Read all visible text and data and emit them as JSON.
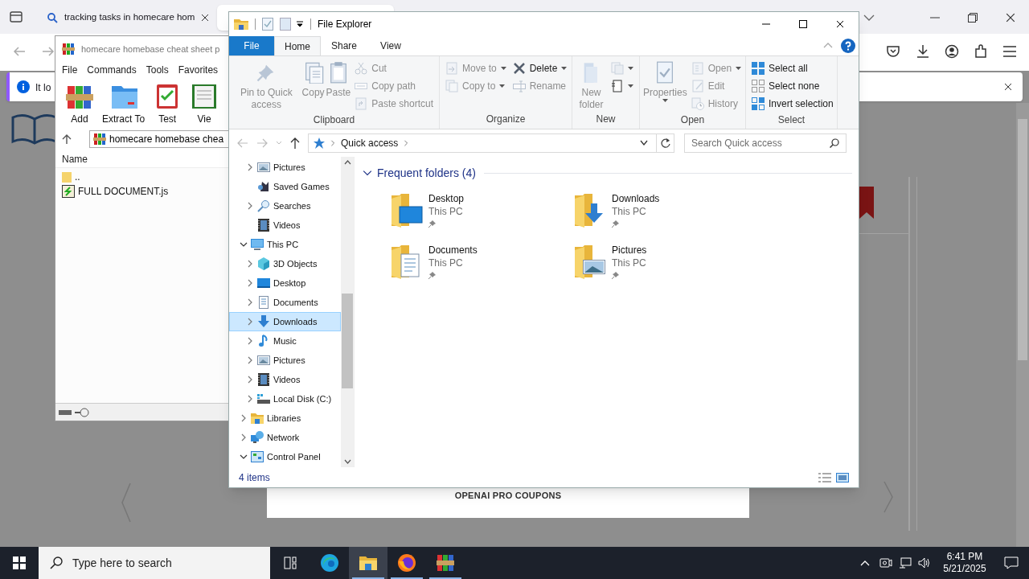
{
  "browser": {
    "tabs": [
      {
        "title": "tracking tasks in homecare hom",
        "selected": false
      },
      {
        "selected": true
      }
    ],
    "notification": "It lo"
  },
  "page": {
    "heading": "OPENAI PRO COUPONS"
  },
  "winrar": {
    "title": "homecare homebase cheat sheet p",
    "menu": [
      "File",
      "Commands",
      "Tools",
      "Favorites"
    ],
    "toolbar": [
      "Add",
      "Extract To",
      "Test",
      "Vie"
    ],
    "address": "homecare homebase chea",
    "column": "Name",
    "files": [
      {
        "name": ".."
      },
      {
        "name": "FULL DOCUMENT.js"
      }
    ]
  },
  "explorer": {
    "title": "File Explorer",
    "tabs": [
      {
        "label": "File",
        "kind": "file",
        "selected": false
      },
      {
        "label": "Home",
        "kind": "tab",
        "selected": true
      },
      {
        "label": "Share",
        "kind": "tab",
        "selected": false
      },
      {
        "label": "View",
        "kind": "tab",
        "selected": false
      }
    ],
    "ribbon": [
      {
        "label": "Clipboard",
        "items": [
          {
            "kind": "large",
            "label": "Pin to Quick access",
            "disabled": true,
            "menu": false
          },
          {
            "kind": "large",
            "label": "Copy",
            "disabled": true,
            "menu": false
          },
          {
            "kind": "large",
            "label": "Paste",
            "disabled": true,
            "menu": false
          },
          {
            "kind": "stack",
            "commands": [
              {
                "label": "Cut",
                "disabled": true,
                "menu": false
              },
              {
                "label": "Copy path",
                "disabled": true,
                "menu": false
              },
              {
                "label": "Paste shortcut",
                "disabled": true,
                "menu": false
              }
            ]
          }
        ]
      },
      {
        "label": "Organize",
        "items": [
          {
            "kind": "stack",
            "commands": [
              {
                "label": "Move to",
                "disabled": true,
                "menu": true
              },
              {
                "label": "Copy to",
                "disabled": true,
                "menu": true
              }
            ]
          },
          {
            "kind": "stack",
            "commands": [
              {
                "label": "Delete",
                "disabled": false,
                "menu": true
              },
              {
                "label": "Rename",
                "disabled": true,
                "menu": false
              }
            ]
          }
        ]
      },
      {
        "label": "New",
        "items": [
          {
            "kind": "large",
            "label": "New folder",
            "disabled": true,
            "menu": false
          },
          {
            "kind": "stack",
            "commands": [
              {
                "disabled": true,
                "menu": true
              },
              {
                "disabled": false,
                "menu": true
              }
            ]
          }
        ]
      },
      {
        "label": "Open",
        "items": [
          {
            "kind": "large",
            "label": "Properties",
            "disabled": true,
            "menu": true
          },
          {
            "kind": "stack",
            "commands": [
              {
                "label": "Open",
                "disabled": true,
                "menu": true
              },
              {
                "label": "Edit",
                "disabled": true,
                "menu": false
              },
              {
                "label": "History",
                "disabled": true,
                "menu": false
              }
            ]
          }
        ]
      },
      {
        "label": "Select",
        "items": [
          {
            "kind": "stack",
            "commands": [
              {
                "label": "Select all",
                "disabled": false,
                "menu": false
              },
              {
                "label": "Select none",
                "disabled": false,
                "menu": false
              },
              {
                "label": "Invert selection",
                "disabled": false,
                "menu": false
              }
            ]
          }
        ]
      }
    ],
    "address": [
      "Quick access"
    ],
    "search": {
      "placeholder": "Search Quick access"
    },
    "nav": {
      "partial": [
        {
          "label": "Pictures",
          "expandable": true,
          "expanded": false,
          "selected": false
        },
        {
          "label": "Saved Games",
          "expandable": false,
          "selected": false
        },
        {
          "label": "Searches",
          "expandable": true,
          "expanded": false,
          "selected": false
        },
        {
          "label": "Videos",
          "expandable": false,
          "selected": false
        }
      ],
      "tree": [
        {
          "label": "This PC",
          "expandable": true,
          "expanded": true,
          "selected": false,
          "children": [
            {
              "label": "3D Objects",
              "expandable": true,
              "expanded": false,
              "selected": false
            },
            {
              "label": "Desktop",
              "expandable": true,
              "expanded": false,
              "selected": false
            },
            {
              "label": "Documents",
              "expandable": true,
              "expanded": false,
              "selected": false
            },
            {
              "label": "Downloads",
              "expandable": true,
              "expanded": false,
              "selected": true
            },
            {
              "label": "Music",
              "expandable": true,
              "expanded": false,
              "selected": false
            },
            {
              "label": "Pictures",
              "expandable": true,
              "expanded": false,
              "selected": false
            },
            {
              "label": "Videos",
              "expandable": true,
              "expanded": false,
              "selected": false
            },
            {
              "label": "Local Disk (C:)",
              "expandable": true,
              "expanded": false,
              "selected": false
            }
          ]
        },
        {
          "label": "Libraries",
          "expandable": true,
          "expanded": false,
          "selected": false
        },
        {
          "label": "Network",
          "expandable": true,
          "expanded": false,
          "selected": false
        },
        {
          "label": "Control Panel",
          "expandable": true,
          "expanded": true,
          "selected": false
        }
      ]
    },
    "content": {
      "group": "Frequent folders (4)",
      "expanded": true,
      "folders": [
        {
          "name": "Desktop",
          "location": "This PC",
          "pinned": true
        },
        {
          "name": "Downloads",
          "location": "This PC",
          "pinned": true
        },
        {
          "name": "Documents",
          "location": "This PC",
          "pinned": true
        },
        {
          "name": "Pictures",
          "location": "This PC",
          "pinned": true
        }
      ]
    },
    "status": "4 items"
  },
  "taskbar": {
    "search_placeholder": "Type here to search",
    "apps": [
      {
        "running": false,
        "active": false
      },
      {
        "running": true,
        "active": true
      },
      {
        "running": true,
        "active": false
      },
      {
        "running": true,
        "active": false
      }
    ],
    "time": "6:41 PM",
    "date": "5/21/2025"
  }
}
